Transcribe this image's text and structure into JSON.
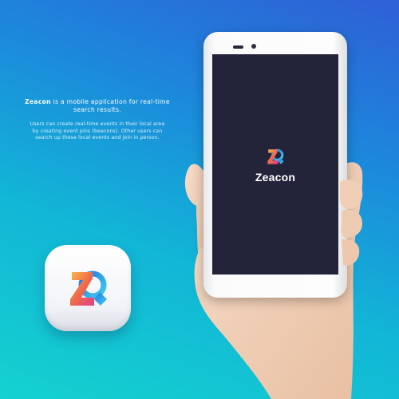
{
  "description": {
    "tagline_brand": "Zeacon",
    "tagline_rest": " is a mobile application for real-time search results.",
    "paragraph": "Users can create real-time events in their local area by creating event pins (beacons). Other users can search up these local events and join in person."
  },
  "phone": {
    "app_name": "Zeacon"
  },
  "icons": {
    "logo": "zeacon-logo-icon"
  },
  "colors": {
    "background_top": "#2f5fd6",
    "background_bottom": "#14d2cf",
    "screen": "#23243a",
    "logo_orange": "#f59a3a",
    "logo_pink": "#e53f86",
    "logo_blue": "#2f7fe8",
    "logo_cyan": "#29c7e6"
  }
}
